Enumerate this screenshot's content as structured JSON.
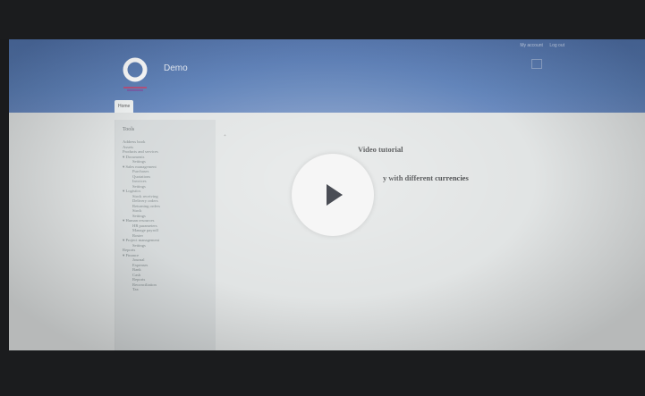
{
  "header": {
    "user_links": [
      "My account",
      "Log out"
    ],
    "site_name": "Demo",
    "home_tab": "Home"
  },
  "sidebar": {
    "title": "Tools",
    "items": [
      {
        "label": "Address book",
        "level": 0
      },
      {
        "label": "Assets",
        "level": 0
      },
      {
        "label": "Products and services",
        "level": 0
      },
      {
        "label": "▾ Documents",
        "level": 0
      },
      {
        "label": "Settings",
        "level": 1
      },
      {
        "label": "▾ Sales management",
        "level": 0
      },
      {
        "label": "Purchases",
        "level": 1
      },
      {
        "label": "Quotations",
        "level": 1
      },
      {
        "label": "Invoices",
        "level": 1
      },
      {
        "label": "Settings",
        "level": 1
      },
      {
        "label": "▾ Logistics",
        "level": 0
      },
      {
        "label": "Stock receiving",
        "level": 1
      },
      {
        "label": "Delivery orders",
        "level": 1
      },
      {
        "label": "Returning orders",
        "level": 1
      },
      {
        "label": "Stock",
        "level": 1
      },
      {
        "label": "Settings",
        "level": 1
      },
      {
        "label": "▾ Human resources",
        "level": 0
      },
      {
        "label": "HR parameters",
        "level": 1
      },
      {
        "label": "Manage payroll",
        "level": 1
      },
      {
        "label": "Roster",
        "level": 1
      },
      {
        "label": "▾ Project management",
        "level": 0
      },
      {
        "label": "Settings",
        "level": 1
      },
      {
        "label": "Reports",
        "level": 0
      },
      {
        "label": "▾ Finance",
        "level": 0
      },
      {
        "label": "Journal",
        "level": 1
      },
      {
        "label": "Expenses",
        "level": 1
      },
      {
        "label": "Bank",
        "level": 1
      },
      {
        "label": "Cash",
        "level": 1
      },
      {
        "label": "Reports",
        "level": 1
      },
      {
        "label": "Reconciliation",
        "level": 1
      },
      {
        "label": "Tax",
        "level": 1
      }
    ]
  },
  "main": {
    "marker": "+",
    "title": "Video tutorial",
    "subtitle": "y with different currencies"
  },
  "player": {
    "play_icon": "play-icon"
  }
}
